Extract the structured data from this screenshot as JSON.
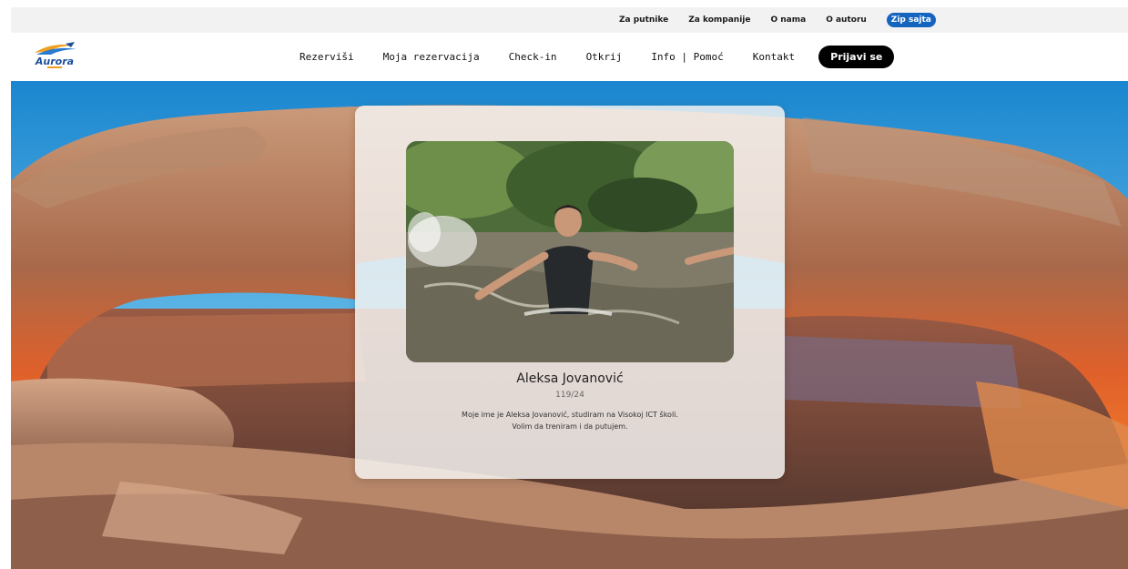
{
  "topbar": {
    "links": [
      "Za putnike",
      "Za kompanije",
      "O nama",
      "O autoru"
    ],
    "zip_label": "Zip sajta"
  },
  "logo": {
    "text": "Aurora"
  },
  "nav": {
    "items": [
      "Rezerviši",
      "Moja rezervacija",
      "Check-in",
      "Otkrij",
      "Info | Pomoć",
      "Kontakt"
    ],
    "login_label": "Prijavi se"
  },
  "author": {
    "name": "Aleksa Jovanović",
    "index": "119/24",
    "bio_line1": "Moje ime je Aleksa Jovanović, studiram na Visokoj ICT školi.",
    "bio_line2": "Volim da treniram i da putujem."
  },
  "colors": {
    "accent": "#1565c0",
    "login_bg": "#000000",
    "topbar_bg": "#f2f2f2"
  }
}
